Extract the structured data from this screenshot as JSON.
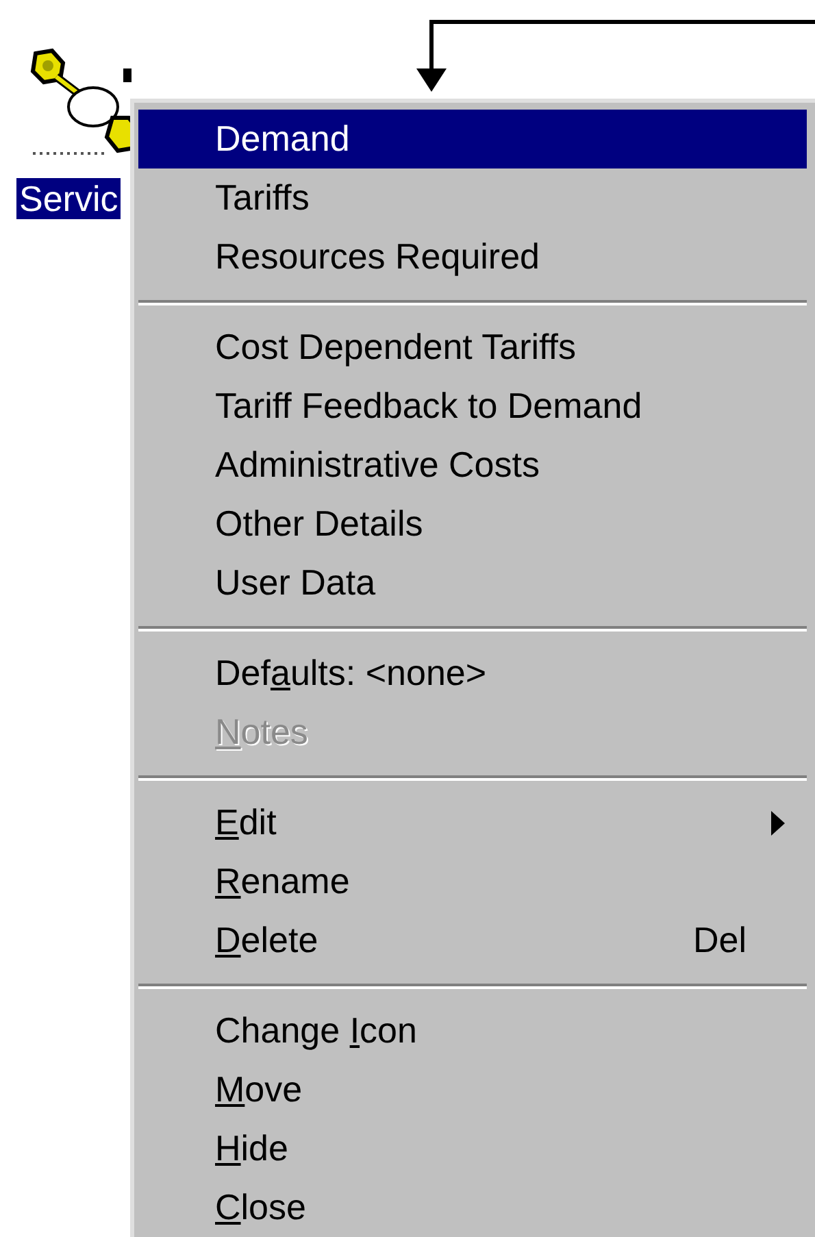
{
  "desktop_icon": {
    "label": "Servic",
    "selected": true
  },
  "menu": {
    "groups": [
      {
        "items": [
          {
            "label": "Demand",
            "selected": true,
            "disabled": false
          },
          {
            "label": "Tariffs",
            "selected": false,
            "disabled": false
          },
          {
            "label": "Resources Required",
            "selected": false,
            "disabled": false
          }
        ]
      },
      {
        "items": [
          {
            "label": "Cost Dependent Tariffs",
            "selected": false,
            "disabled": false
          },
          {
            "label": "Tariff Feedback to Demand",
            "selected": false,
            "disabled": false
          },
          {
            "label": "Administrative Costs",
            "selected": false,
            "disabled": false
          },
          {
            "label": "Other Details",
            "selected": false,
            "disabled": false
          },
          {
            "label": "User Data",
            "selected": false,
            "disabled": false
          }
        ]
      },
      {
        "items": [
          {
            "label": "Def",
            "access_key": "a",
            "label_rest": "ults: <none>",
            "selected": false,
            "disabled": false
          },
          {
            "access_key": "N",
            "label_rest": "otes",
            "selected": false,
            "disabled": true
          }
        ]
      },
      {
        "items": [
          {
            "access_key": "E",
            "label_rest": "dit",
            "submenu": true,
            "selected": false,
            "disabled": false
          },
          {
            "access_key": "R",
            "label_rest": "ename",
            "selected": false,
            "disabled": false
          },
          {
            "access_key": "D",
            "label_rest": "elete",
            "shortcut": "Del",
            "selected": false,
            "disabled": false
          }
        ]
      },
      {
        "items": [
          {
            "label": "Change ",
            "access_key": "I",
            "label_rest": "con",
            "selected": false,
            "disabled": false
          },
          {
            "access_key": "M",
            "label_rest": "ove",
            "selected": false,
            "disabled": false
          },
          {
            "access_key": "H",
            "label_rest": "ide",
            "selected": false,
            "disabled": false
          },
          {
            "access_key": "C",
            "label_rest": "lose",
            "selected": false,
            "disabled": false
          }
        ]
      }
    ]
  }
}
